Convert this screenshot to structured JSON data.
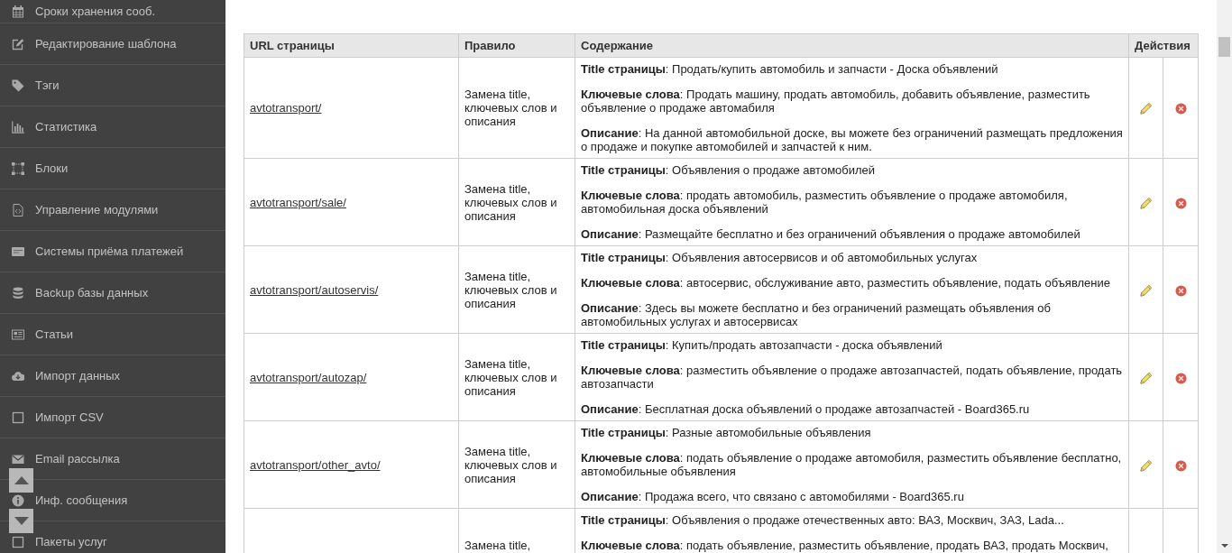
{
  "sidebar": {
    "items": [
      "Сроки хранения сооб.",
      "Редактирование шаблона",
      "Тэги",
      "Статистика",
      "Блоки",
      "Управление модулями",
      "Системы приёма платежей",
      "Backup базы данных",
      "Статьи",
      "Импорт данных",
      "Импорт CSV",
      "Email рассылка",
      "Инф. сообщения",
      "Пакеты услуг"
    ]
  },
  "table": {
    "columns": [
      "URL страницы",
      "Правило",
      "Содержание",
      "Действия"
    ],
    "rows": [
      {
        "url": "avtotransport/",
        "rule": "Замена title, ключевых слов и описания",
        "title": "**Title страницы**: Продать/купить автомобиль и запчасти - Доска объявлений",
        "keywords": "**Ключевые слова**: Продать машину, продать автомобиль, добавить объявление, разместить объявление о продаже автомабиля",
        "description": "**Описание**: На данной автомобильной доске, вы можете без ограничений размещать предложения о продаже и покупке автомобилей и запчастей к ним."
      },
      {
        "url": "avtotransport/sale/",
        "rule": "Замена title, ключевых слов и описания",
        "title": "**Title страницы**: Объявления о продаже автомобилей",
        "keywords": "**Ключевые слова**: продать автомобиль, разместить объявление о продаже автомобиля, автомобильная доска объявлений",
        "description": "**Описание**: Размещайте бесплатно и без ограничений объявления о продаже автомобилей"
      },
      {
        "url": "avtotransport/autoservis/",
        "rule": "Замена title, ключевых слов и описания",
        "title": "**Title страницы**: Объявления автосервисов и об автомобильных услугах",
        "keywords": "**Ключевые слова**: автосервис, обслуживание авто, разместить объявление, подать объявление",
        "description": "**Описание**: Здесь вы можете бесплатно и без ограничений размещать объявления об автомобильных услугах и автосервисах"
      },
      {
        "url": "avtotransport/autozap/",
        "rule": "Замена title, ключевых слов и описания",
        "title": "**Title страницы**: Купить/продать автозапчасти - доска объявлений",
        "keywords": "**Ключевые слова**: разместить объявление о продаже автозапчастей, подать объявление, продать автозапчасти",
        "description": "**Описание**: Бесплатная доска объявлений о продаже автозапчастей - Board365.ru"
      },
      {
        "url": "avtotransport/other_avto/",
        "rule": "Замена title, ключевых слов и описания",
        "title": "**Title страницы**: Разные автомобильные объявления",
        "keywords": "**Ключевые слова**: подать объявление о продаже автомобиля, разместить объявление бесплатно, автомобильные объявления",
        "description": "**Описание**: Продажа всего, что связано с автомобилями - Board365.ru"
      },
      {
        "rule": "Замена title,",
        "title": "**Title страницы**: Объявления о продаже отечественных авто: ВАЗ, Москвич, ЗАЗ, Lada...",
        "keywords": "**Ключевые слова**: подать объявление, разместить объявление, продать ВАЗ, продать Москвич,"
      }
    ]
  }
}
